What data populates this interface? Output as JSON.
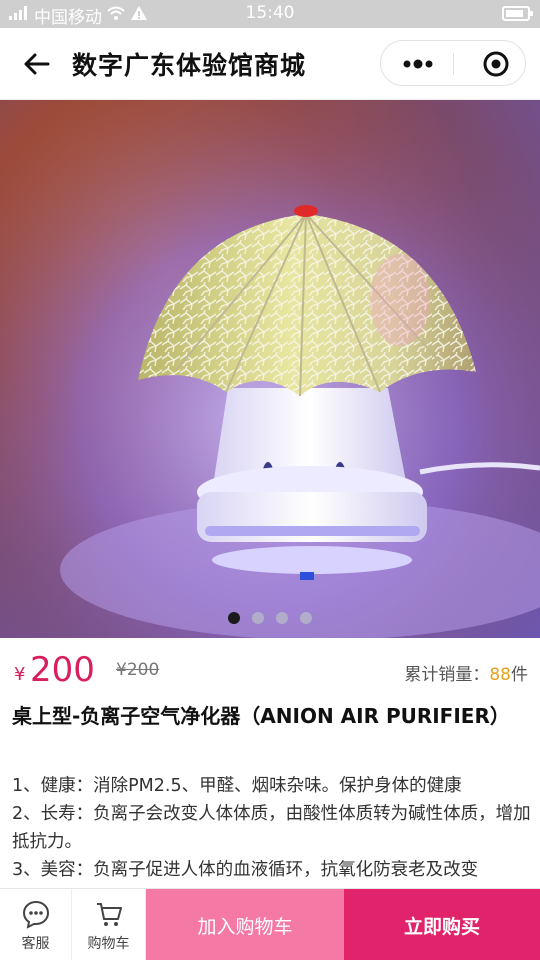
{
  "status": {
    "carrier": "中国移动",
    "time": "15:40"
  },
  "nav": {
    "title": "数字广东体验馆商城"
  },
  "product": {
    "currency": "¥",
    "price": "200",
    "original_price": "¥200",
    "sales_label": "累计销量：",
    "sales_count": "88",
    "sales_unit": "件",
    "title": "桌上型-负离子空气净化器（ANION AIR PURIFIER）",
    "description": [
      "1、健康：消除PM2.5、甲醛、烟味杂味。保护身体的健康",
      "2、长寿：负离子会改变人体体质，由酸性体质转为碱性体质，增加抵抗力。",
      "3、美容：负离子促进人体的血液循环，抗氧化防衰老及改变"
    ]
  },
  "carousel": {
    "count": 4,
    "active": 0
  },
  "bottom": {
    "service_label": "客服",
    "cart_label": "购物车",
    "add_cart_label": "加入购物车",
    "buy_label": "立即购买"
  },
  "colors": {
    "price": "#d81e5b",
    "sales_count": "#e8a21a",
    "add_cart_bg": "#f47aa5",
    "buy_bg": "#e0236a"
  }
}
